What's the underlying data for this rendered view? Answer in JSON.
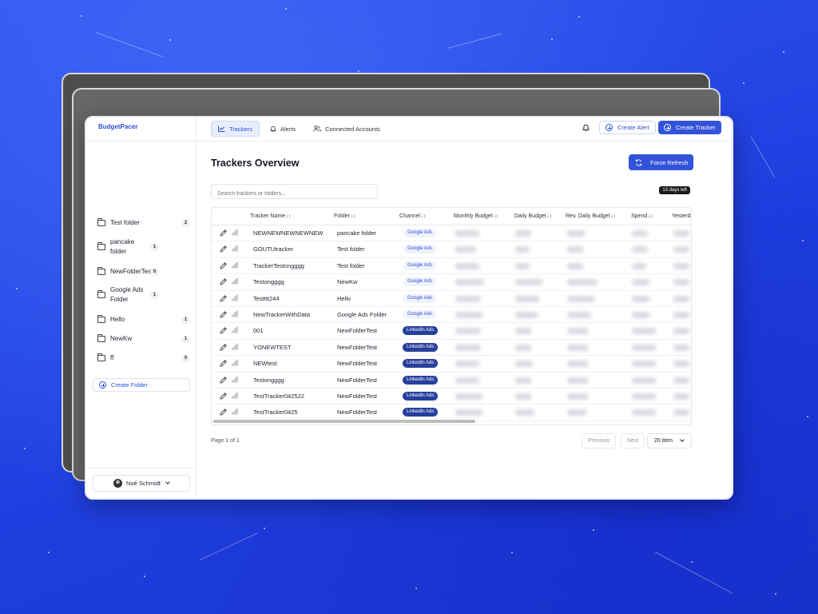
{
  "app": {
    "brand": "BudgetPacer"
  },
  "tabs": [
    {
      "label": "Trackers",
      "active": true
    },
    {
      "label": "Alerts",
      "active": false
    },
    {
      "label": "Connected Accounts",
      "active": false
    }
  ],
  "header_actions": {
    "create_alert": "Create Alert",
    "create_tracker": "Create Tracker"
  },
  "sidebar": {
    "folders": [
      {
        "name": "Test folder",
        "count": "2"
      },
      {
        "name": "pancake folder",
        "count": "1"
      },
      {
        "name": "NewFolderTest",
        "count": "6"
      },
      {
        "name": "Google Ads Folder",
        "count": "1"
      },
      {
        "name": "Hello",
        "count": "1"
      },
      {
        "name": "NewKw",
        "count": "1"
      },
      {
        "name": "ff",
        "count": "0"
      }
    ],
    "create_folder": "Create Folder",
    "user_name": "Noé Schmidt"
  },
  "main": {
    "title": "Trackers Overview",
    "force_refresh": "Force Refresh",
    "search_placeholder": "Search trackers or folders...",
    "days_left": "13 days left"
  },
  "table": {
    "columns": [
      "Tracker Name",
      "Folder",
      "Channel",
      "Monthly Budget",
      "Daily Budget",
      "Rev. Daily Budget",
      "Spend",
      "Yesterd"
    ],
    "rows": [
      {
        "name": "NEWNEWNEWNEWNEW",
        "folder": "pancake folder",
        "channel": "Google Ads"
      },
      {
        "name": "GOUTUtracker",
        "folder": "Test folder",
        "channel": "Google Ads"
      },
      {
        "name": "TrackerTestongggg",
        "folder": "Test folder",
        "channel": "Google Ads"
      },
      {
        "name": "Testongggg",
        "folder": "NewKw",
        "channel": "Google Ads"
      },
      {
        "name": "Testttt244",
        "folder": "Hello",
        "channel": "Google Ads"
      },
      {
        "name": "NewTrackerWithData",
        "folder": "Google Ads Folder",
        "channel": "Google Ads"
      },
      {
        "name": "001",
        "folder": "NewFolderTest",
        "channel": "LinkedIn Ads"
      },
      {
        "name": "YONEWTEST",
        "folder": "NewFolderTest",
        "channel": "LinkedIn Ads"
      },
      {
        "name": "NEWtest",
        "folder": "NewFolderTest",
        "channel": "LinkedIn Ads"
      },
      {
        "name": "Testongggg",
        "folder": "NewFolderTest",
        "channel": "LinkedIn Ads"
      },
      {
        "name": "TestTracker042522",
        "folder": "NewFolderTest",
        "channel": "LinkedIn Ads"
      },
      {
        "name": "TestTracker0425",
        "folder": "NewFolderTest",
        "channel": "LinkedIn Ads"
      }
    ]
  },
  "pagination": {
    "label": "Page 1 of 1",
    "previous": "Previous",
    "next": "Next",
    "page_size": "20 item"
  },
  "colors": {
    "accent": "#3353d9",
    "background": "#2348e6",
    "linkedin_badge": "#263f9c"
  }
}
